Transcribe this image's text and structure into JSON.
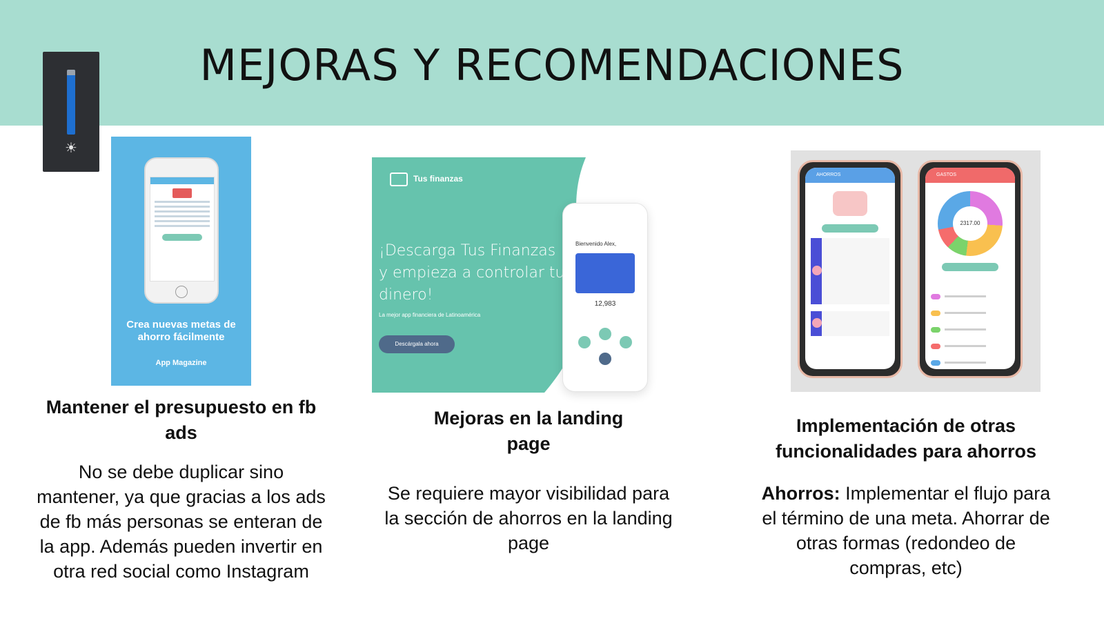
{
  "title": "MEJORAS Y RECOMENDACIONES",
  "columns": [
    {
      "image_caption": "Crea nuevas metas de ahorro fácilmente",
      "image_source": "App Magazine",
      "heading": "Mantener el presupuesto en fb ads",
      "body": "No se debe duplicar  sino mantener, ya que gracias a los ads de fb más personas se enteran de la app. Además pueden invertir en otra red social como Instagram"
    },
    {
      "image_brand": "Tus finanzas",
      "image_headline": "¡Descarga Tus Finanzas y empieza a controlar tu dinero!",
      "image_subline": "La mejor app financiera de Latinoamérica",
      "image_button": "Descárgala ahora",
      "image_greeting": "Bienvenido Alex,",
      "image_amount": "12,983",
      "heading": "Mejoras en la landing page",
      "body": "Se requiere mayor visibilidad para la sección de ahorros en la landing page"
    },
    {
      "image_left_title": "AHORROS",
      "image_right_title": "GASTOS",
      "image_total": "2317.00",
      "heading": "Implementación de otras funcionalidades para ahorros",
      "body_bold": "Ahorros:",
      "body": " Implementar el flujo para el término de una meta. Ahorrar de otras formas (redondeo de compras, etc)"
    }
  ],
  "colors": {
    "header_bg": "#a8ddd0",
    "blue_panel": "#5cb6e4",
    "green_panel": "#66c3ad"
  }
}
